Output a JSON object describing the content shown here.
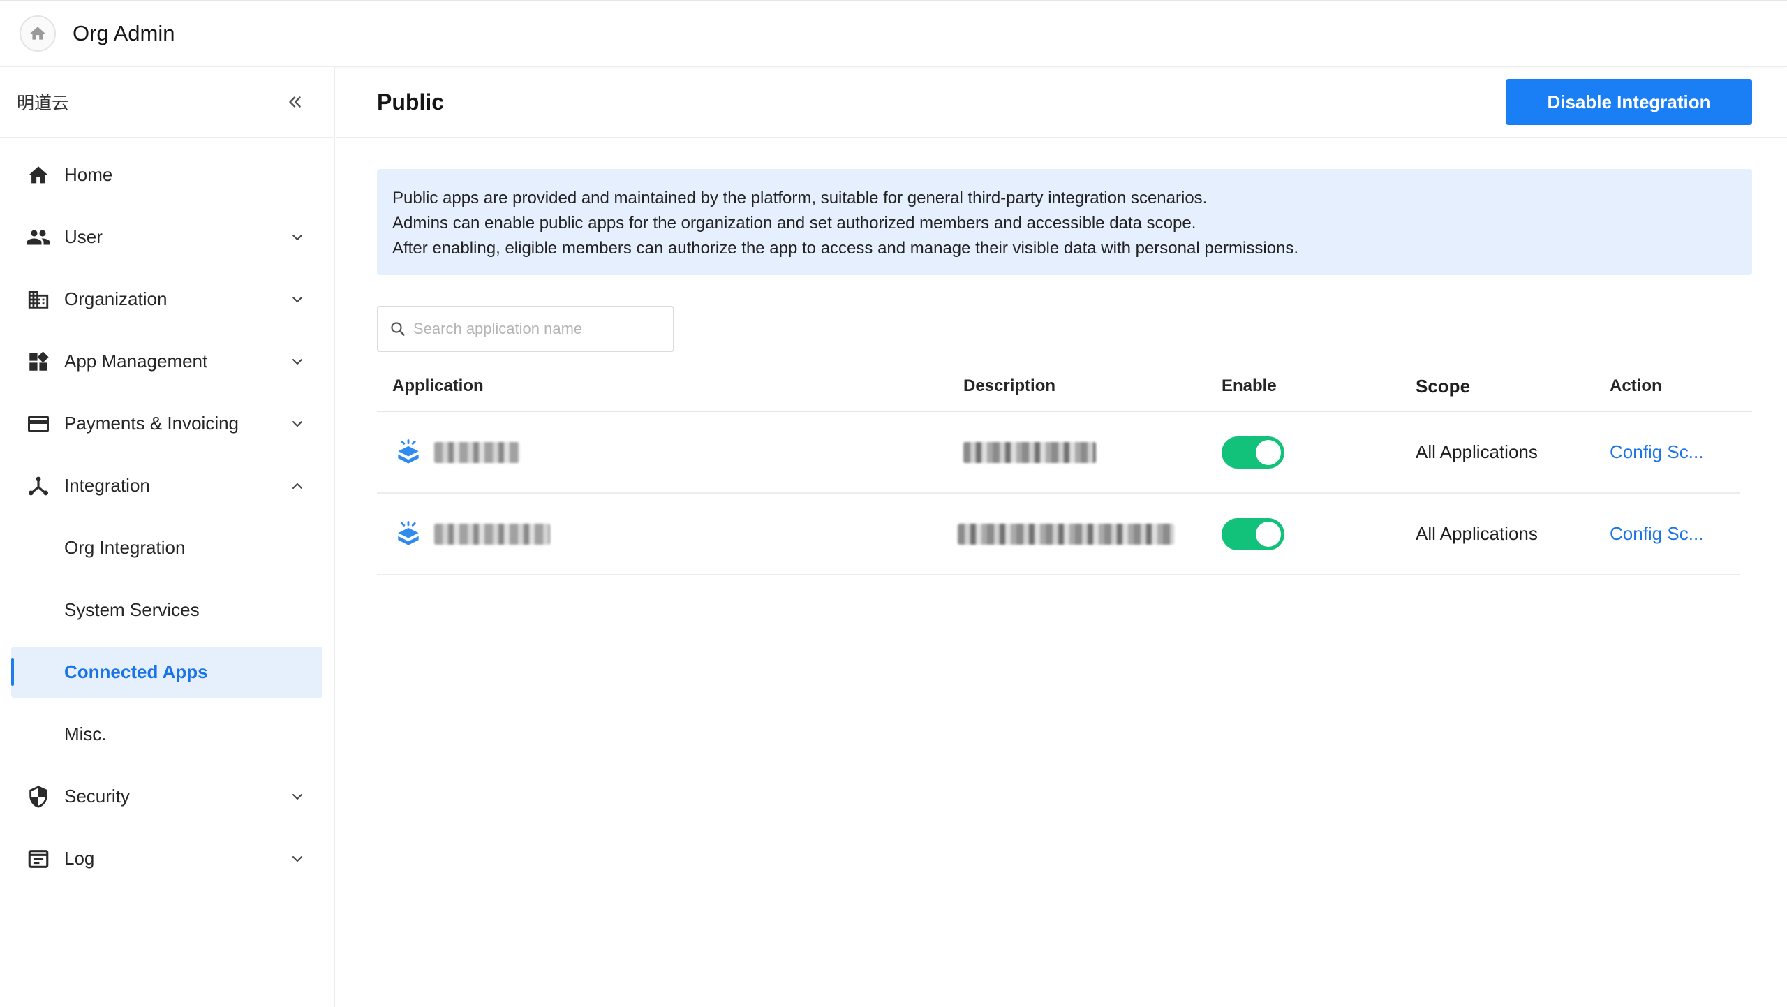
{
  "header": {
    "app_title": "Org Admin",
    "home_icon": "home-icon"
  },
  "sidebar": {
    "org_name": "明道云",
    "collapse_icon": "double-chevron-left-icon",
    "items": [
      {
        "label": "Home",
        "icon": "home-icon"
      },
      {
        "label": "User",
        "icon": "users-icon",
        "expanded": false
      },
      {
        "label": "Organization",
        "icon": "building-icon",
        "expanded": false
      },
      {
        "label": "App Management",
        "icon": "widgets-icon",
        "expanded": false
      },
      {
        "label": "Payments & Invoicing",
        "icon": "credit-card-icon",
        "expanded": false
      },
      {
        "label": "Integration",
        "icon": "hub-icon",
        "expanded": true
      },
      {
        "label": "Security",
        "icon": "shield-icon",
        "expanded": false
      },
      {
        "label": "Log",
        "icon": "log-icon",
        "expanded": false
      }
    ],
    "integration_sub": [
      {
        "label": "Org Integration"
      },
      {
        "label": "System Services"
      },
      {
        "label": "Connected Apps",
        "active": true
      },
      {
        "label": "Misc."
      }
    ]
  },
  "main": {
    "title": "Public",
    "primary_button": "Disable Integration",
    "info_lines": [
      "Public apps are provided and maintained by the platform, suitable for general third-party integration scenarios.",
      "Admins can enable public apps for the organization and set authorized members and accessible data scope.",
      "After enabling, eligible members can authorize the app to access and manage their visible data with personal permissions."
    ],
    "search": {
      "placeholder": "Search application name",
      "value": ""
    },
    "table": {
      "columns": [
        "Application",
        "Description",
        "Enable",
        "Scope",
        "Action"
      ],
      "rows": [
        {
          "enabled": true,
          "scope": "All Applications",
          "action": "Config Sc..."
        },
        {
          "enabled": true,
          "scope": "All Applications",
          "action": "Config Sc..."
        }
      ]
    }
  },
  "colors": {
    "accent": "#1a7ef5",
    "toggle_on": "#12c27a",
    "info_bg": "#e5effd",
    "active_nav_bg": "#e6f0fd"
  }
}
